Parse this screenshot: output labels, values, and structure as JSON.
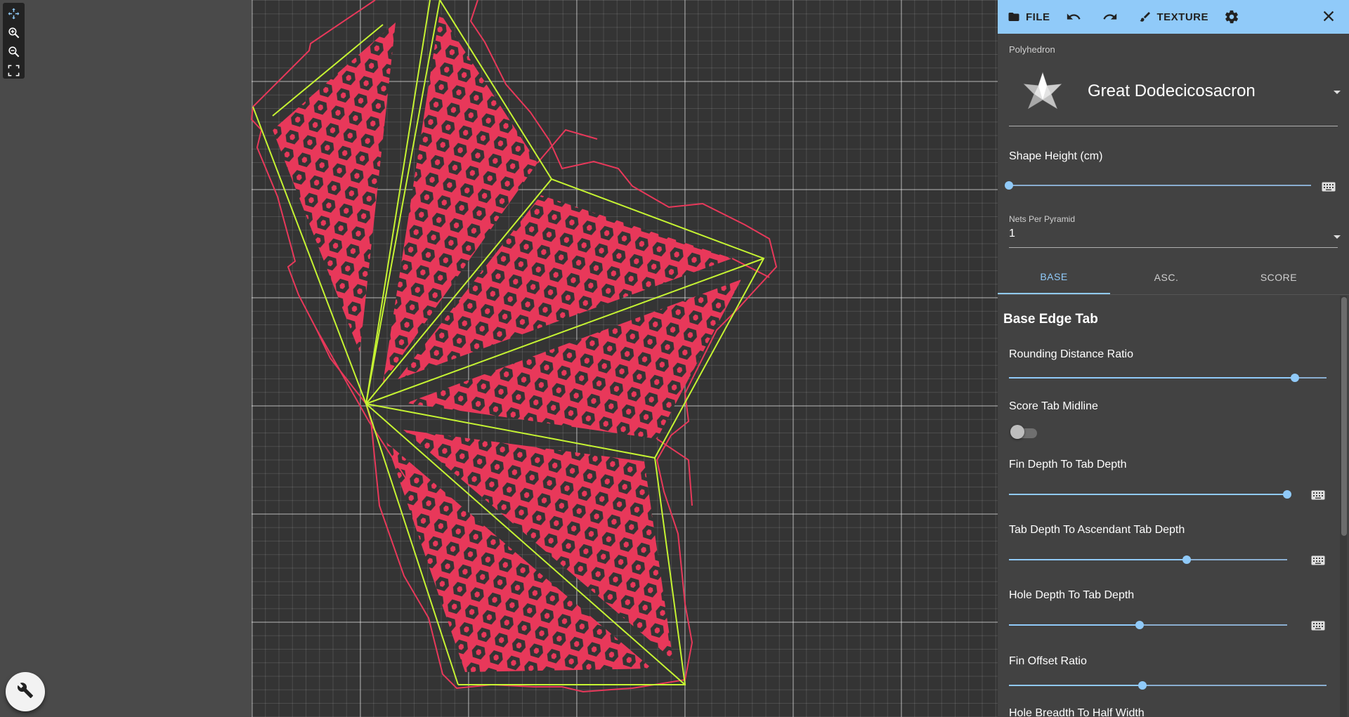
{
  "toolbar": {
    "file_label": "FILE",
    "texture_label": "TEXTURE"
  },
  "polyhedron": {
    "label": "Polyhedron",
    "value": "Great Dodecicosacron"
  },
  "shape_height": {
    "label": "Shape Height (cm)",
    "fraction": 0.0
  },
  "nets_per_pyramid": {
    "label": "Nets Per Pyramid",
    "value": "1"
  },
  "tabs": [
    {
      "label": "BASE",
      "active": true
    },
    {
      "label": "ASC.",
      "active": false
    },
    {
      "label": "SCORE",
      "active": false
    }
  ],
  "section": {
    "title": "Base Edge Tab",
    "fields": [
      {
        "label": "Rounding Distance Ratio",
        "fraction": 0.9
      },
      {
        "label": "Score Tab Midline",
        "toggle": false
      },
      {
        "label": "Fin Depth To Tab Depth",
        "fraction": 1.0
      },
      {
        "label": "Tab Depth To Ascendant Tab Depth",
        "fraction": 0.64
      },
      {
        "label": "Hole Depth To Tab Depth",
        "fraction": 0.47
      },
      {
        "label": "Fin Offset Ratio",
        "fraction": 0.42
      },
      {
        "label": "Hole Breadth To Half Width"
      }
    ]
  },
  "colors": {
    "accent": "#90caf9",
    "cut_line": "#e8385a",
    "score_line": "#c6f432",
    "panel_bg": "#424242"
  },
  "icons": {
    "toolbar": [
      "folder-icon",
      "undo-icon",
      "redo-icon",
      "brush-icon",
      "gear-icon",
      "close-icon"
    ],
    "canvas_tools": [
      "pan-icon",
      "zoom-in-icon",
      "zoom-out-icon",
      "fit-screen-icon"
    ],
    "fab": "wrench-icon"
  }
}
